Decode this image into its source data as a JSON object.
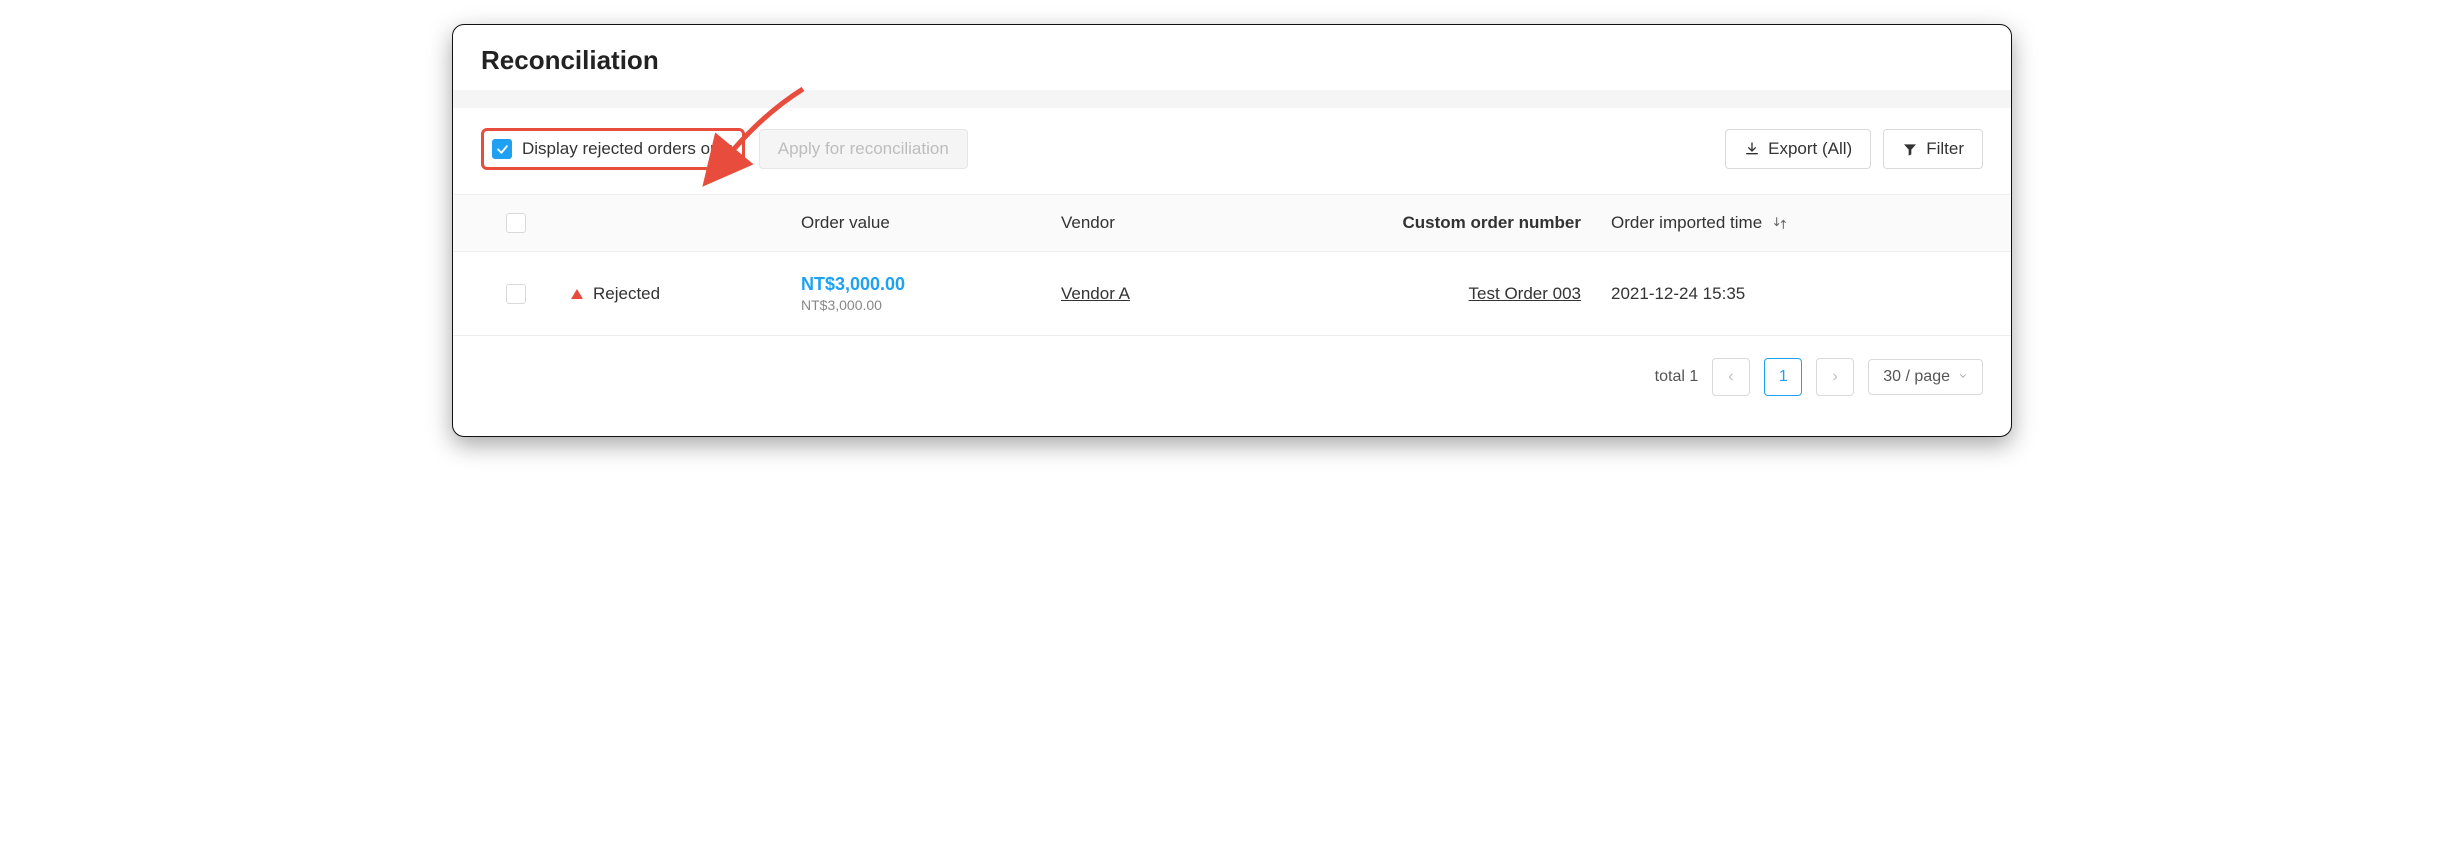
{
  "page": {
    "title": "Reconciliation"
  },
  "toolbar": {
    "display_rejected_only": {
      "label": "Display rejected orders only",
      "checked": true
    },
    "apply_label": "Apply for reconciliation",
    "export_label": "Export (All)",
    "filter_label": "Filter"
  },
  "table": {
    "headers": {
      "order_value": "Order value",
      "vendor": "Vendor",
      "custom_order_number": "Custom order number",
      "order_imported_time": "Order imported time"
    },
    "rows": [
      {
        "status": "Rejected",
        "order_value_primary": "NT$3,000.00",
        "order_value_secondary": "NT$3,000.00",
        "vendor": "Vendor A",
        "custom_order_number": "Test Order 003",
        "imported_time": "2021-12-24 15:35"
      }
    ]
  },
  "pagination": {
    "total_label": "total 1",
    "current": "1",
    "page_size_label": "30 / page"
  }
}
